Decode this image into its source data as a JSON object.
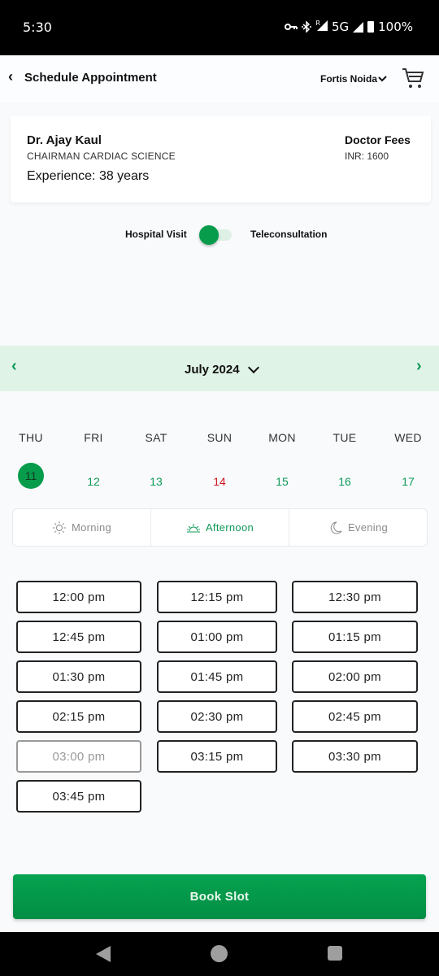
{
  "status_bar": {
    "time": "5:30",
    "network": "5G",
    "roaming": "R",
    "battery": "100%"
  },
  "header": {
    "title": "Schedule Appointment",
    "location": "Fortis Noida"
  },
  "doctor": {
    "name": "Dr. Ajay Kaul",
    "designation": "CHAIRMAN CARDIAC SCIENCE",
    "experience": "Experience: 38 years",
    "fees_label": "Doctor Fees",
    "fees_value": "INR: 1600"
  },
  "visit_type": {
    "left_label": "Hospital Visit",
    "right_label": "Teleconsultation",
    "selected": "Hospital Visit"
  },
  "calendar": {
    "month": "July 2024",
    "days": [
      {
        "dow": "THU",
        "date": "11",
        "state": "selected"
      },
      {
        "dow": "FRI",
        "date": "12",
        "state": "available"
      },
      {
        "dow": "SAT",
        "date": "13",
        "state": "available"
      },
      {
        "dow": "SUN",
        "date": "14",
        "state": "sunday"
      },
      {
        "dow": "MON",
        "date": "15",
        "state": "available"
      },
      {
        "dow": "TUE",
        "date": "16",
        "state": "available"
      },
      {
        "dow": "WED",
        "date": "17",
        "state": "available"
      }
    ]
  },
  "period_tabs": [
    {
      "label": "Morning",
      "icon": "sun-icon",
      "active": false
    },
    {
      "label": "Afternoon",
      "icon": "sunrise-icon",
      "active": true
    },
    {
      "label": "Evening",
      "icon": "moon-icon",
      "active": false
    }
  ],
  "slots": [
    {
      "time": "12:00 pm",
      "available": true
    },
    {
      "time": "12:15 pm",
      "available": true
    },
    {
      "time": "12:30 pm",
      "available": true
    },
    {
      "time": "12:45 pm",
      "available": true
    },
    {
      "time": "01:00 pm",
      "available": true
    },
    {
      "time": "01:15 pm",
      "available": true
    },
    {
      "time": "01:30 pm",
      "available": true
    },
    {
      "time": "01:45 pm",
      "available": true
    },
    {
      "time": "02:00 pm",
      "available": true
    },
    {
      "time": "02:15 pm",
      "available": true
    },
    {
      "time": "02:30 pm",
      "available": true
    },
    {
      "time": "02:45 pm",
      "available": true
    },
    {
      "time": "03:00 pm",
      "available": false
    },
    {
      "time": "03:15 pm",
      "available": true
    },
    {
      "time": "03:30 pm",
      "available": true
    },
    {
      "time": "03:45 pm",
      "available": true
    }
  ],
  "book_button": "Book Slot",
  "colors": {
    "accent": "#069c4b",
    "month_bar": "#e0f3e7",
    "sunday": "#d0141f"
  }
}
